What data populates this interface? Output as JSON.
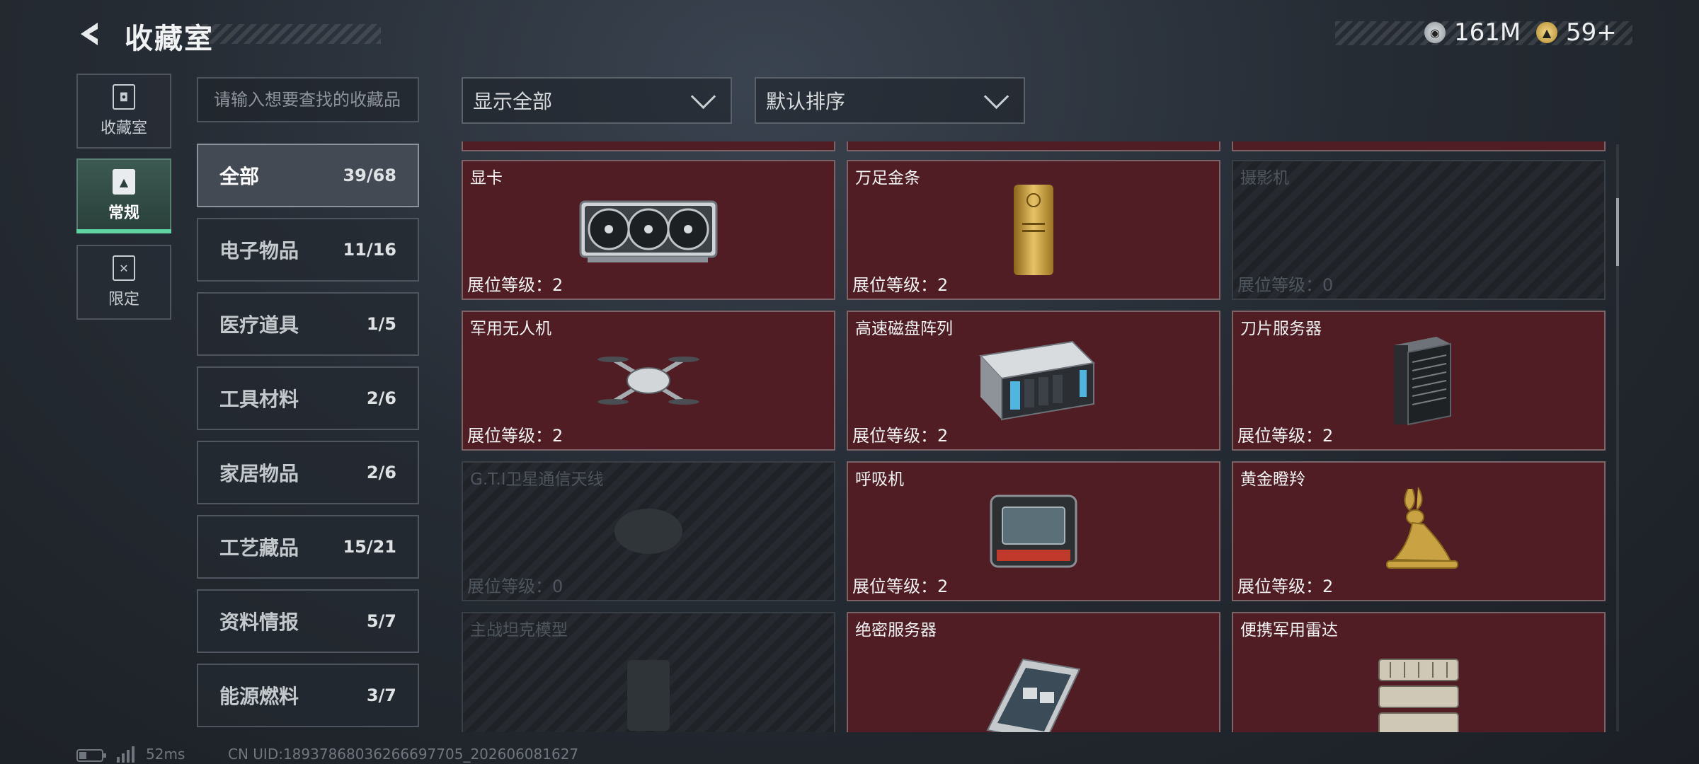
{
  "header": {
    "title": "收藏室"
  },
  "currency": [
    {
      "icon": "silver-coin-icon",
      "value": "161M"
    },
    {
      "icon": "gold-coin-icon",
      "value": "59+"
    }
  ],
  "nav": [
    {
      "label": "收藏室",
      "icon": "collection-room-icon"
    },
    {
      "label": "常规",
      "icon": "regular-icon",
      "active": true
    },
    {
      "label": "限定",
      "icon": "limited-icon"
    }
  ],
  "search": {
    "placeholder": "请输入想要查找的收藏品"
  },
  "categories": [
    {
      "label": "全部",
      "count": "39/68",
      "active": true
    },
    {
      "label": "电子物品",
      "count": "11/16"
    },
    {
      "label": "医疗道具",
      "count": "1/5"
    },
    {
      "label": "工具材料",
      "count": "2/6"
    },
    {
      "label": "家居物品",
      "count": "2/6"
    },
    {
      "label": "工艺藏品",
      "count": "15/21"
    },
    {
      "label": "资料情报",
      "count": "5/7"
    },
    {
      "label": "能源燃料",
      "count": "3/7"
    }
  ],
  "filters": {
    "display": "显示全部",
    "sort": "默认排序"
  },
  "items": [
    {
      "name": "显卡",
      "level": "展位等级：2",
      "owned": true,
      "icon": "gpu-icon"
    },
    {
      "name": "万足金条",
      "level": "展位等级：2",
      "owned": true,
      "icon": "gold-bar-icon"
    },
    {
      "name": "摄影机",
      "level": "展位等级：0",
      "owned": false,
      "icon": "camera-icon"
    },
    {
      "name": "军用无人机",
      "level": "展位等级：2",
      "owned": true,
      "icon": "drone-icon"
    },
    {
      "name": "高速磁盘阵列",
      "level": "展位等级：2",
      "owned": true,
      "icon": "disk-array-icon"
    },
    {
      "name": "刀片服务器",
      "level": "展位等级：2",
      "owned": true,
      "icon": "blade-server-icon"
    },
    {
      "name": "G.T.I卫星通信天线",
      "level": "展位等级：0",
      "owned": false,
      "icon": "satellite-antenna-icon"
    },
    {
      "name": "呼吸机",
      "level": "展位等级：2",
      "owned": true,
      "icon": "ventilator-icon"
    },
    {
      "name": "黄金瞪羚",
      "level": "展位等级：2",
      "owned": true,
      "icon": "gold-gazelle-icon"
    },
    {
      "name": "主战坦克模型",
      "level": "",
      "owned": false,
      "icon": "tank-model-icon"
    },
    {
      "name": "绝密服务器",
      "level": "",
      "owned": true,
      "icon": "secret-server-icon"
    },
    {
      "name": "便携军用雷达",
      "level": "",
      "owned": true,
      "icon": "radar-icon"
    }
  ],
  "footer": {
    "latency": "52ms",
    "uid": "CN UID:18937868036266697705_202606081627"
  },
  "colors": {
    "card_owned": "#4f1d23",
    "accent_green": "#5fd3a1"
  }
}
